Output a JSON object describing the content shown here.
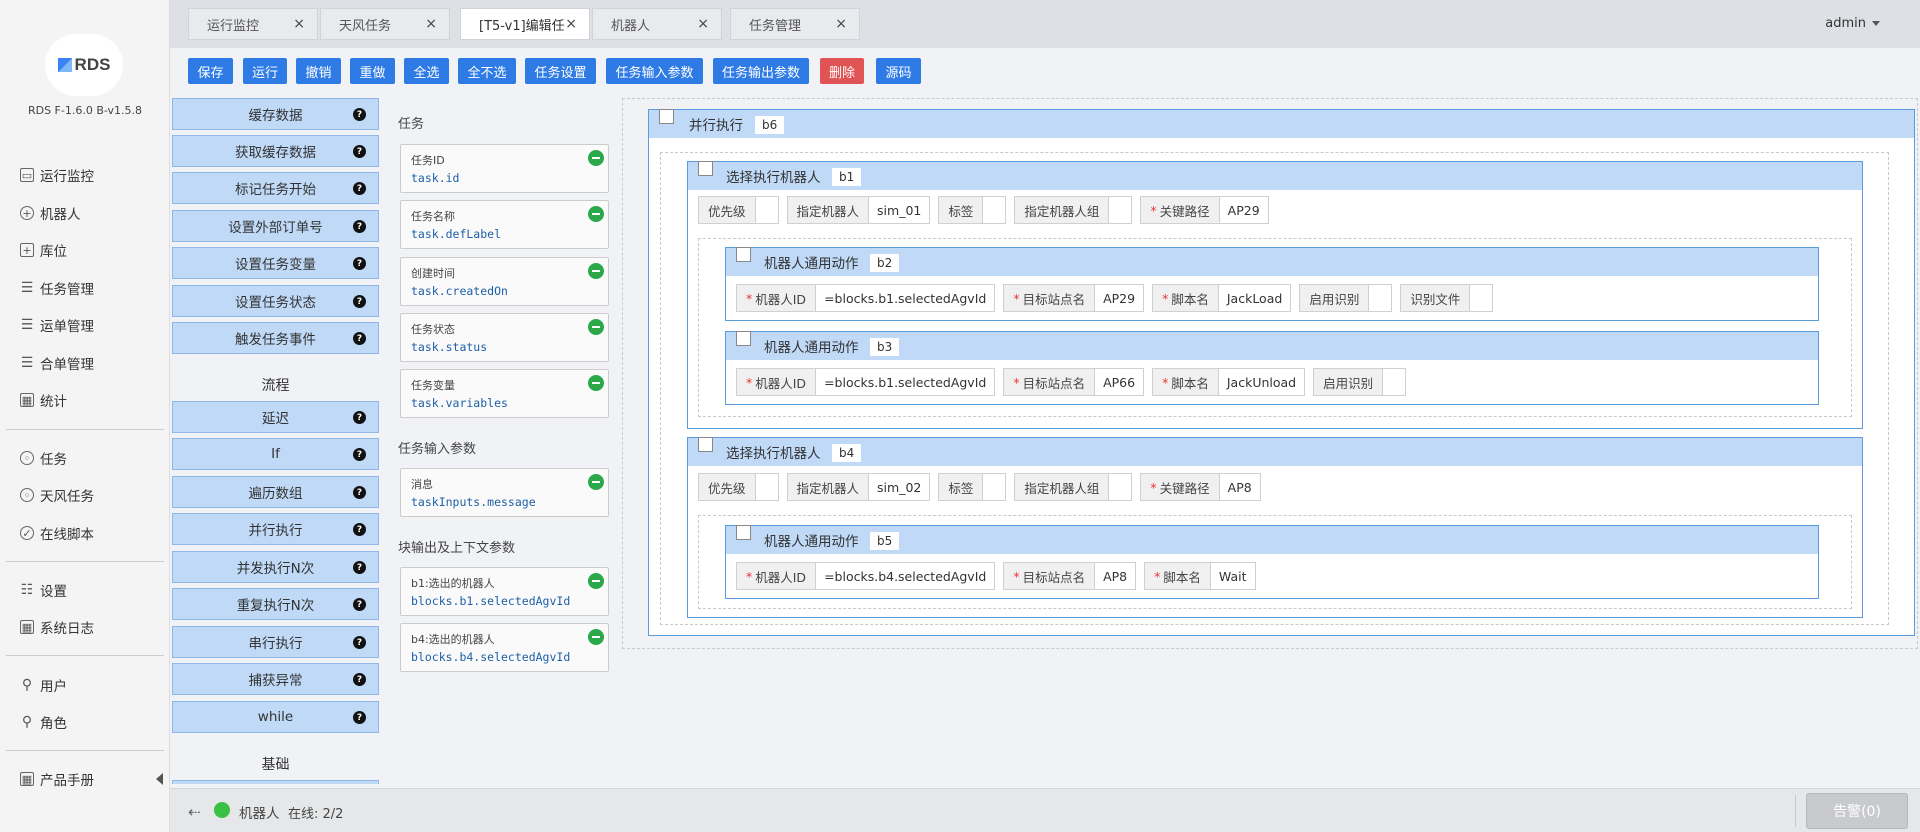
{
  "sidebar": {
    "brand": "RDS",
    "version": "RDS F-1.6.0 B-v1.5.8",
    "groups": [
      [
        {
          "label": "运行监控",
          "icon": "monitor-icon"
        },
        {
          "label": "机器人",
          "icon": "robot-icon"
        },
        {
          "label": "库位",
          "icon": "storage-icon"
        },
        {
          "label": "任务管理",
          "icon": "list-icon"
        },
        {
          "label": "运单管理",
          "icon": "waybill-icon"
        },
        {
          "label": "合单管理",
          "icon": "merge-icon"
        },
        {
          "label": "统计",
          "icon": "stats-icon"
        }
      ],
      [
        {
          "label": "任务",
          "icon": "task-icon"
        },
        {
          "label": "天风任务",
          "icon": "tianfeng-task-icon"
        },
        {
          "label": "在线脚本",
          "icon": "script-icon"
        }
      ],
      [
        {
          "label": "设置",
          "icon": "settings-icon"
        },
        {
          "label": "系统日志",
          "icon": "log-icon"
        }
      ],
      [
        {
          "label": "用户",
          "icon": "user-icon"
        },
        {
          "label": "角色",
          "icon": "role-icon"
        }
      ],
      [
        {
          "label": "产品手册",
          "icon": "manual-icon"
        }
      ]
    ]
  },
  "tabs": [
    {
      "label": "运行监控",
      "close": "×"
    },
    {
      "label": "天风任务",
      "close": "×"
    },
    {
      "label": "[T5-v1]编辑任",
      "close": "×",
      "active": true
    },
    {
      "label": "机器人",
      "close": "×"
    },
    {
      "label": "任务管理",
      "close": "×"
    }
  ],
  "user": "admin",
  "toolbar": [
    "保存",
    "运行",
    "撤销",
    "重做",
    "全选",
    "全不选",
    "任务设置",
    "任务输入参数",
    "任务输出参数",
    "删除",
    "源码"
  ],
  "palette": {
    "items_a": [
      "缓存数据",
      "获取缓存数据",
      "标记任务开始",
      "设置外部订单号",
      "设置任务变量",
      "设置任务状态",
      "触发任务事件"
    ],
    "header_flow": "流程",
    "items_b": [
      "延迟",
      "If",
      "遍历数组",
      "并行执行",
      "并发执行N次",
      "重复执行N次",
      "串行执行",
      "捕获异常",
      "while"
    ],
    "header_basic": "基础",
    "help": "?"
  },
  "variables": {
    "task_header": "任务",
    "task_vars": [
      {
        "label": "任务ID",
        "path": "task.id"
      },
      {
        "label": "任务名称",
        "path": "task.defLabel"
      },
      {
        "label": "创建时间",
        "path": "task.createdOn"
      },
      {
        "label": "任务状态",
        "path": "task.status"
      },
      {
        "label": "任务变量",
        "path": "task.variables"
      }
    ],
    "input_header": "任务输入参数",
    "input_vars": [
      {
        "label": "消息",
        "path": "taskInputs.message"
      }
    ],
    "output_header": "块输出及上下文参数",
    "output_vars": [
      {
        "label": "b1:选出的机器人",
        "path": "blocks.b1.selectedAgvId"
      },
      {
        "label": "b4:选出的机器人",
        "path": "blocks.b4.selectedAgvId"
      }
    ]
  },
  "canvas": {
    "root": {
      "title": "并行执行",
      "id": "b6"
    },
    "b1": {
      "title": "选择执行机器人",
      "id": "b1",
      "params": [
        {
          "label": "优先级",
          "value": ""
        },
        {
          "label": "指定机器人",
          "value": "sim_01"
        },
        {
          "label": "标签",
          "value": ""
        },
        {
          "label": "指定机器人组",
          "value": ""
        },
        {
          "label": "关键路径",
          "value": "AP29",
          "required": "*"
        }
      ]
    },
    "b2": {
      "title": "机器人通用动作",
      "id": "b2",
      "params": [
        {
          "label": "机器人ID",
          "value": "=blocks.b1.selectedAgvId",
          "required": "*"
        },
        {
          "label": "目标站点名",
          "value": "AP29",
          "required": "*"
        },
        {
          "label": "脚本名",
          "value": "JackLoad",
          "required": "*"
        },
        {
          "label": "启用识别",
          "value": ""
        },
        {
          "label": "识别文件",
          "value": ""
        }
      ]
    },
    "b3": {
      "title": "机器人通用动作",
      "id": "b3",
      "params": [
        {
          "label": "机器人ID",
          "value": "=blocks.b1.selectedAgvId",
          "required": "*"
        },
        {
          "label": "目标站点名",
          "value": "AP66",
          "required": "*"
        },
        {
          "label": "脚本名",
          "value": "JackUnload",
          "required": "*"
        },
        {
          "label": "启用识别",
          "value": ""
        }
      ]
    },
    "b4": {
      "title": "选择执行机器人",
      "id": "b4",
      "params": [
        {
          "label": "优先级",
          "value": ""
        },
        {
          "label": "指定机器人",
          "value": "sim_02"
        },
        {
          "label": "标签",
          "value": ""
        },
        {
          "label": "指定机器人组",
          "value": ""
        },
        {
          "label": "关键路径",
          "value": "AP8",
          "required": "*"
        }
      ]
    },
    "b5": {
      "title": "机器人通用动作",
      "id": "b5",
      "params": [
        {
          "label": "机器人ID",
          "value": "=blocks.b4.selectedAgvId",
          "required": "*"
        },
        {
          "label": "目标站点名",
          "value": "AP8",
          "required": "*"
        },
        {
          "label": "脚本名",
          "value": "Wait",
          "required": "*"
        }
      ]
    }
  },
  "status": {
    "robot_label": "机器人",
    "online": "在线: 2/2",
    "online_color": "#3bc046",
    "alarm": "告警(0)"
  }
}
